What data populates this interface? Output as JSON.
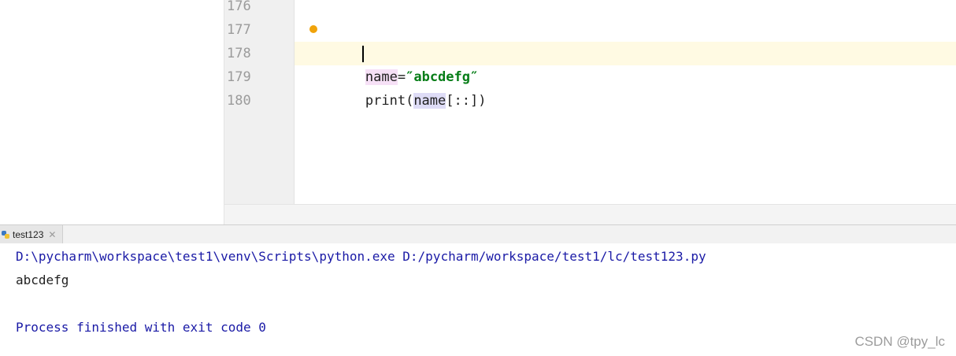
{
  "editor": {
    "line_numbers": [
      "176",
      "177",
      "178",
      "179",
      "180"
    ],
    "code": {
      "line177": {
        "name_prefix": "n",
        "name_rest": "ame",
        "equals": "=",
        "string": "″abcdefg″"
      },
      "line178": {
        "print_open": "print(",
        "name_a": "na",
        "name_b": "me",
        "slice_close": "[::])"
      }
    }
  },
  "run_panel": {
    "tab_label": "test123",
    "close_icon": "close-icon",
    "console": {
      "command": "D:\\pycharm\\workspace\\test1\\venv\\Scripts\\python.exe D:/pycharm/workspace/test1/lc/test123.py",
      "output": "abcdefg",
      "process": "Process finished with exit code 0"
    }
  },
  "watermark": "CSDN @tpy_lc",
  "colors": {
    "string": "#067d17",
    "console_blue": "#1a1aa6",
    "current_line": "#fffae3",
    "warning": "#f0a30a"
  }
}
